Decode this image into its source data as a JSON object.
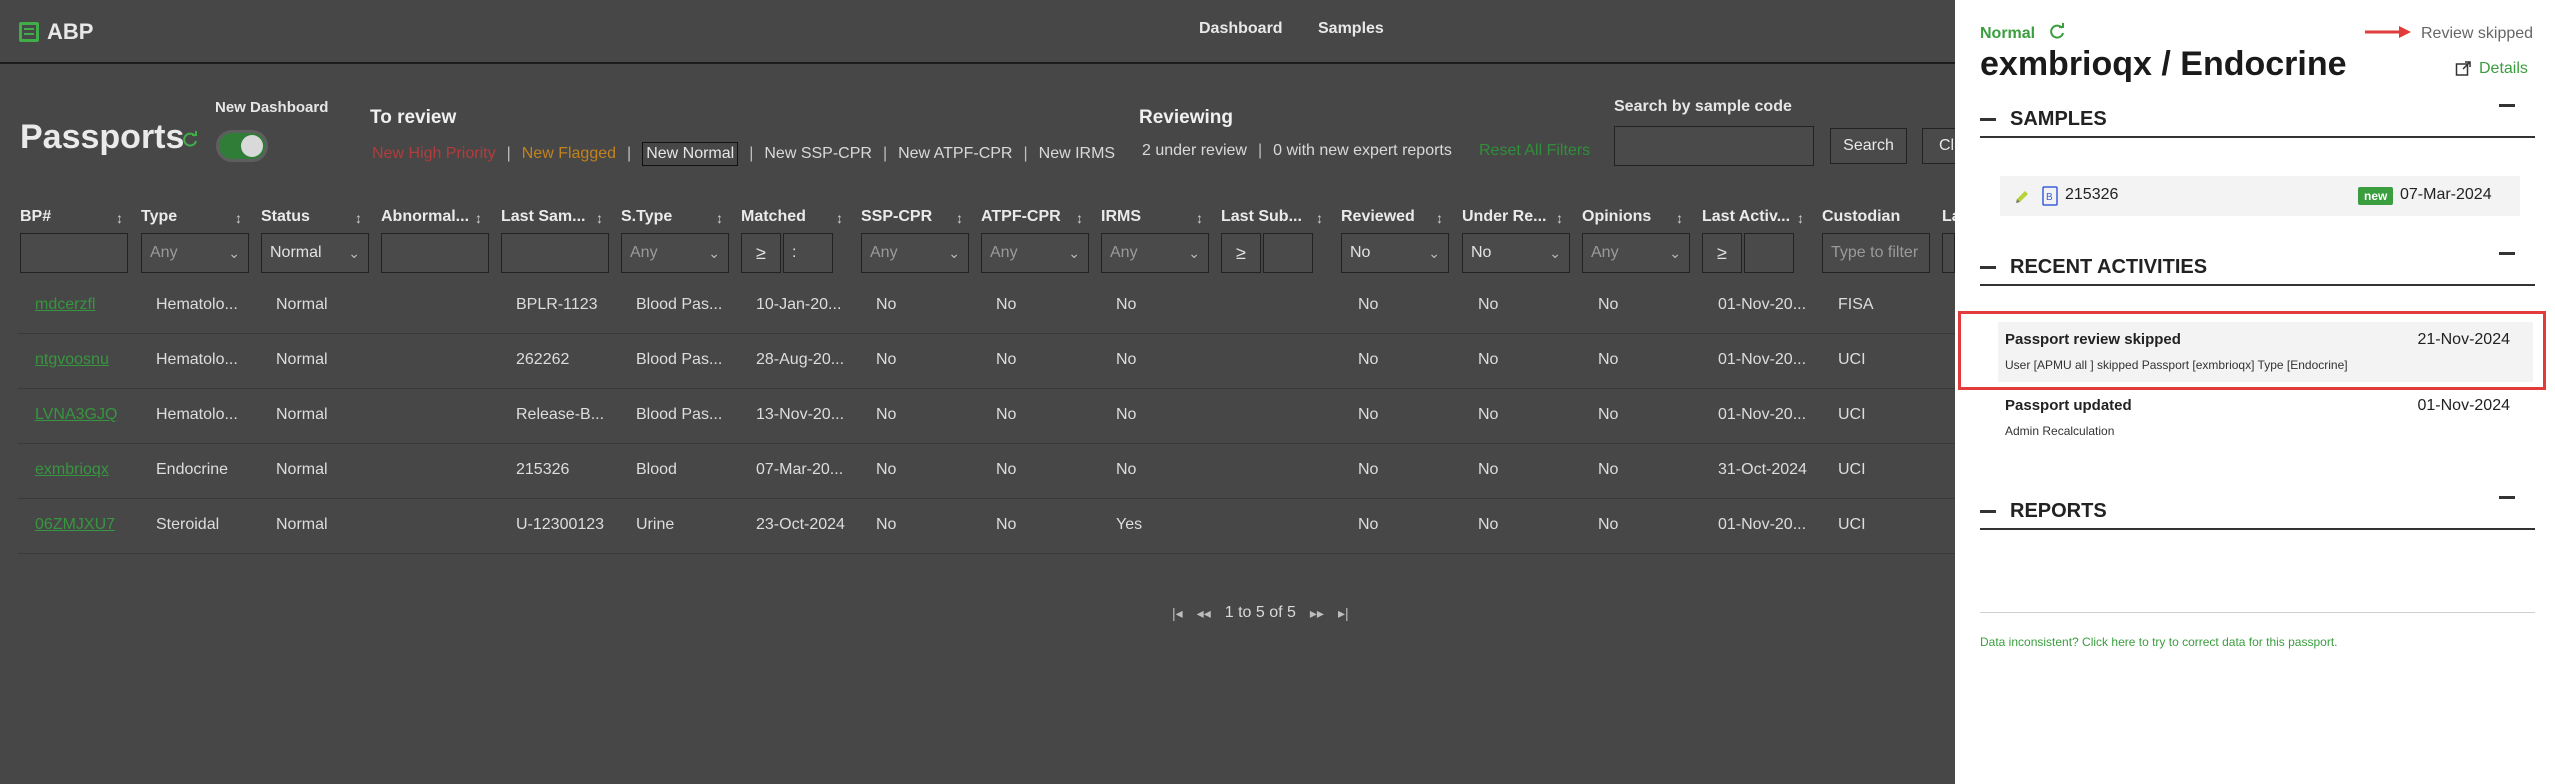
{
  "app": {
    "name": "ABP"
  },
  "nav": {
    "dashboard": "Dashboard",
    "samples": "Samples"
  },
  "page": {
    "title": "Passports",
    "new_dashboard_label": "New Dashboard",
    "new_dashboard_on": true
  },
  "to_review": {
    "heading": "To review",
    "filters": [
      {
        "label": "New High Priority"
      },
      {
        "label": "New Flagged"
      },
      {
        "label": "New Normal"
      },
      {
        "label": "New SSP-CPR"
      },
      {
        "label": "New ATPF-CPR"
      },
      {
        "label": "New IRMS"
      }
    ]
  },
  "reviewing": {
    "heading": "Reviewing",
    "under_review": "2 under review",
    "expert_reports": "0 with new expert reports",
    "reset": "Reset All Filters"
  },
  "search": {
    "label": "Search by sample code",
    "button": "Search",
    "clear_button": "Cl"
  },
  "table": {
    "headers": [
      "BP#",
      "Type",
      "Status",
      "Abnormal...",
      "Last Sam...",
      "S.Type",
      "Matched",
      "SSP-CPR",
      "ATPF-CPR",
      "IRMS",
      "Last Sub...",
      "Reviewed",
      "Under Re...",
      "Opinions",
      "Last Activ...",
      "Custodian",
      "La"
    ],
    "filters": {
      "type": "Any",
      "status": "Normal",
      "s_type": "Any",
      "matched_op": "≥",
      "matched_val": ":",
      "ssp": "Any",
      "atpf": "Any",
      "irms": "Any",
      "last_sub_op": "≥",
      "reviewed": "No",
      "under_review": "No",
      "opinions": "Any",
      "last_activity_op": "≥",
      "custodian_placeholder": "Type to filter"
    },
    "rows": [
      {
        "bp": "mdcerzfl",
        "type": "Hematolo...",
        "status": "Normal",
        "last_sample": "BPLR-1123",
        "s_type": "Blood Pas...",
        "matched": "10-Jan-20...",
        "ssp": "No",
        "atpf": "No",
        "irms": "No",
        "reviewed": "No",
        "under_review": "No",
        "opinions": "No",
        "last_activity": "01-Nov-20...",
        "custodian": "FISA"
      },
      {
        "bp": "ntgvoosnu",
        "type": "Hematolo...",
        "status": "Normal",
        "last_sample": "262262",
        "s_type": "Blood Pas...",
        "matched": "28-Aug-20...",
        "ssp": "No",
        "atpf": "No",
        "irms": "No",
        "reviewed": "No",
        "under_review": "No",
        "opinions": "No",
        "last_activity": "01-Nov-20...",
        "custodian": "UCI"
      },
      {
        "bp": "LVNA3GJQ",
        "type": "Hematolo...",
        "status": "Normal",
        "last_sample": "Release-B...",
        "s_type": "Blood Pas...",
        "matched": "13-Nov-20...",
        "ssp": "No",
        "atpf": "No",
        "irms": "No",
        "reviewed": "No",
        "under_review": "No",
        "opinions": "No",
        "last_activity": "01-Nov-20...",
        "custodian": "UCI"
      },
      {
        "bp": "exmbrioqx",
        "type": "Endocrine",
        "status": "Normal",
        "last_sample": "215326",
        "s_type": "Blood",
        "matched": "07-Mar-20...",
        "ssp": "No",
        "atpf": "No",
        "irms": "No",
        "reviewed": "No",
        "under_review": "No",
        "opinions": "No",
        "last_activity": "31-Oct-2024",
        "custodian": "UCI"
      },
      {
        "bp": "06ZMJXU7",
        "type": "Steroidal",
        "status": "Normal",
        "last_sample": "U-12300123",
        "s_type": "Urine",
        "matched": "23-Oct-2024",
        "ssp": "No",
        "atpf": "No",
        "irms": "Yes",
        "reviewed": "No",
        "under_review": "No",
        "opinions": "No",
        "last_activity": "01-Nov-20...",
        "custodian": "UCI"
      }
    ]
  },
  "pager": {
    "text": "1 to 5 of 5"
  },
  "panel": {
    "status": "Normal",
    "review_state": "Review skipped",
    "title": "exmbrioqx / Endocrine",
    "details": "Details",
    "samples_heading": "SAMPLES",
    "sample": {
      "code": "215326",
      "badge": "new",
      "date": "07-Mar-2024"
    },
    "activities_heading": "RECENT ACTIVITIES",
    "activities": [
      {
        "title": "Passport review skipped",
        "desc": "User [APMU all ] skipped Passport [exmbrioqx] Type [Endocrine]",
        "date": "21-Nov-2024"
      },
      {
        "title": "Passport updated",
        "desc": "Admin Recalculation",
        "date": "01-Nov-2024"
      }
    ],
    "reports_heading": "REPORTS",
    "footer": "Data inconsistent? Click here to try to correct data for this passport."
  },
  "colors": {
    "accent": "#3a9e3f",
    "high_priority": "#b33c3c",
    "flagged": "#c2831d",
    "highlight": "#e23b3b",
    "overlay_bg": "#474747"
  },
  "icons": [
    "logo-icon",
    "refresh-icon",
    "chevron-down-icon",
    "first-page-icon",
    "prev-page-icon",
    "next-page-icon",
    "last-page-icon",
    "arrow-right-icon",
    "external-link-icon",
    "pencil-icon",
    "document-icon"
  ]
}
